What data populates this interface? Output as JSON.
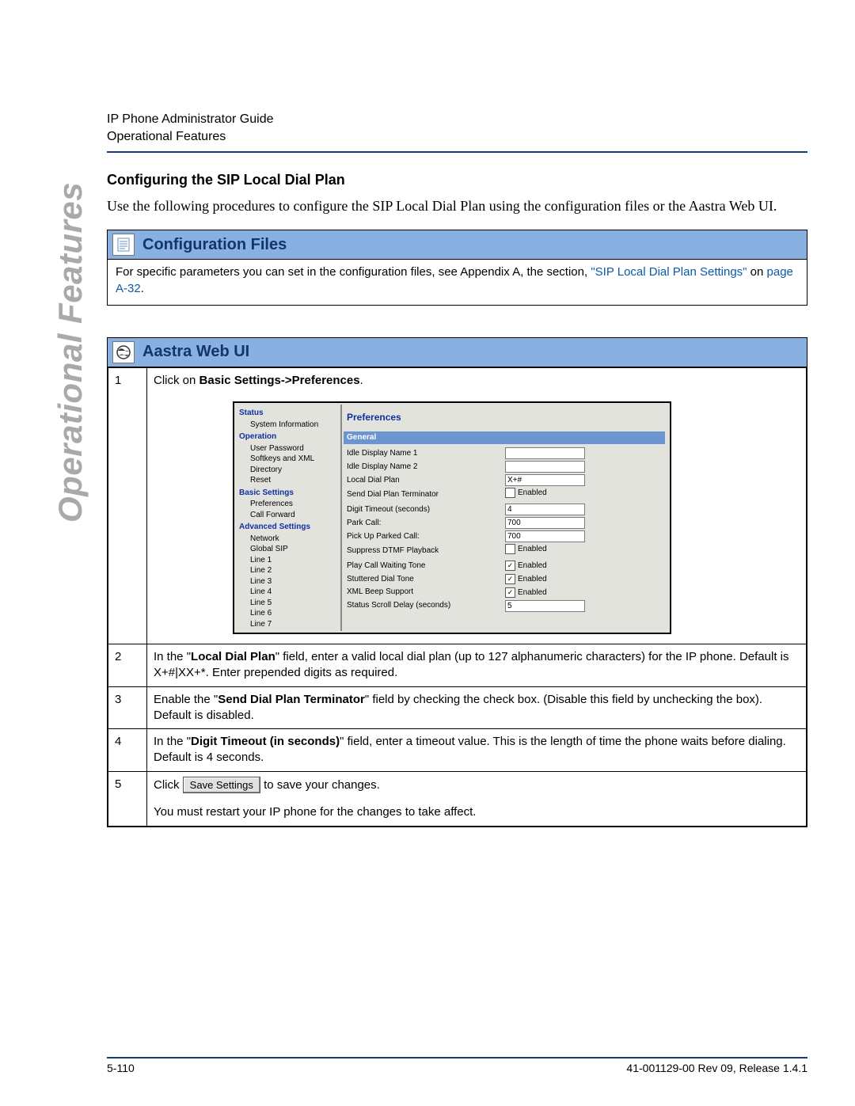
{
  "side_tab": "Operational Features",
  "header": {
    "line1": "IP Phone Administrator Guide",
    "line2": "Operational Features"
  },
  "section": {
    "title": "Configuring the SIP Local Dial Plan",
    "body": "Use the following procedures to configure the SIP Local Dial Plan using the configuration files or the Aastra Web UI."
  },
  "config_files_panel": {
    "title": "Configuration Files",
    "body_prefix": "For specific parameters you can set in the configuration files, see Appendix A, the section, ",
    "link1": "\"SIP Local Dial Plan Settings\"",
    "mid": " on ",
    "link2": "page A-32",
    "suffix": "."
  },
  "web_ui_panel": {
    "title": "Aastra Web UI",
    "step1_prefix": "Click on ",
    "step1_bold": "Basic Settings->Preferences",
    "step1_suffix": ".",
    "step2_a": "In the \"",
    "step2_bold": "Local Dial Plan",
    "step2_b": "\" field, enter a valid local dial plan (up to 127 alphanumeric characters) for the IP phone. Default is X+#|XX+*. Enter prepended digits as required.",
    "step3_a": "Enable the \"",
    "step3_bold": "Send Dial Plan Terminator",
    "step3_b": "\" field by checking the check box. (Disable this field by unchecking the box). Default is disabled.",
    "step4_a": "In the \"",
    "step4_bold": "Digit Timeout (in seconds)",
    "step4_b": "\" field, enter a timeout value. This is the length of time the phone waits before dialing. Default is 4 seconds.",
    "step5_a": "Click ",
    "step5_btn": "Save Settings",
    "step5_b": " to save your changes.",
    "step5_c": "You must restart your IP phone for the changes to take affect.",
    "nums": {
      "n1": "1",
      "n2": "2",
      "n3": "3",
      "n4": "4",
      "n5": "5"
    }
  },
  "screenshot": {
    "nav": {
      "g1": "Status",
      "g1_items": [
        "System Information"
      ],
      "g2": "Operation",
      "g2_items": [
        "User Password",
        "Softkeys and XML",
        "Directory",
        "Reset"
      ],
      "g3": "Basic Settings",
      "g3_items": [
        "Preferences",
        "Call Forward"
      ],
      "g4": "Advanced Settings",
      "g4_items": [
        "Network",
        "Global SIP",
        "Line 1",
        "Line 2",
        "Line 3",
        "Line 4",
        "Line 5",
        "Line 6",
        "Line 7"
      ]
    },
    "main": {
      "title": "Preferences",
      "section": "General",
      "rows": [
        {
          "label": "Idle Display Name 1",
          "type": "text",
          "value": ""
        },
        {
          "label": "Idle Display Name 2",
          "type": "text",
          "value": ""
        },
        {
          "label": "Local Dial Plan",
          "type": "text",
          "value": "X+#"
        },
        {
          "label": "Send Dial Plan Terminator",
          "type": "check",
          "checked": false,
          "text": "Enabled"
        },
        {
          "label": "Digit Timeout (seconds)",
          "type": "text",
          "value": "4"
        },
        {
          "label": "Park Call:",
          "type": "text",
          "value": "700"
        },
        {
          "label": "Pick Up Parked Call:",
          "type": "text",
          "value": "700"
        },
        {
          "label": "Suppress DTMF Playback",
          "type": "check",
          "checked": false,
          "text": "Enabled"
        },
        {
          "label": "Play Call Waiting Tone",
          "type": "check",
          "checked": true,
          "text": "Enabled"
        },
        {
          "label": "Stuttered Dial Tone",
          "type": "check",
          "checked": true,
          "text": "Enabled"
        },
        {
          "label": "XML Beep Support",
          "type": "check",
          "checked": true,
          "text": "Enabled"
        },
        {
          "label": "Status Scroll Delay (seconds)",
          "type": "text",
          "value": "5"
        }
      ]
    }
  },
  "footer": {
    "left": "5-110",
    "right": "41-001129-00 Rev 09, Release 1.4.1"
  }
}
